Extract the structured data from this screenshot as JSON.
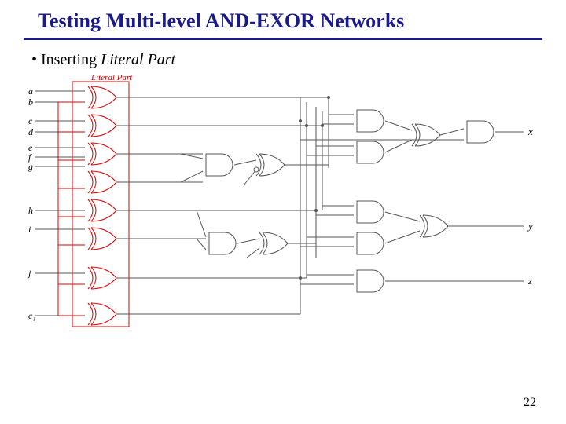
{
  "title": "Testing Multi-level AND-EXOR Networks",
  "bullet_prefix": "Inserting ",
  "bullet_italic": "Literal Part",
  "literal_part_label": "Literal Part",
  "inputs": [
    "a",
    "b",
    "c",
    "d",
    "e",
    "f",
    "g",
    "h",
    "i",
    "j",
    "c₁"
  ],
  "outputs": [
    "x",
    "y",
    "z"
  ],
  "page_number": "22",
  "diagram_description": "Multilevel logic network. Left column (red box) is a stack of 2-input XOR gates forming the Literal Part (inputs a..j, c1). Outputs of literal part feed a middle tier of AND gates and a XOR, then a right tier of XOR and AND gates producing outputs x, y, z."
}
